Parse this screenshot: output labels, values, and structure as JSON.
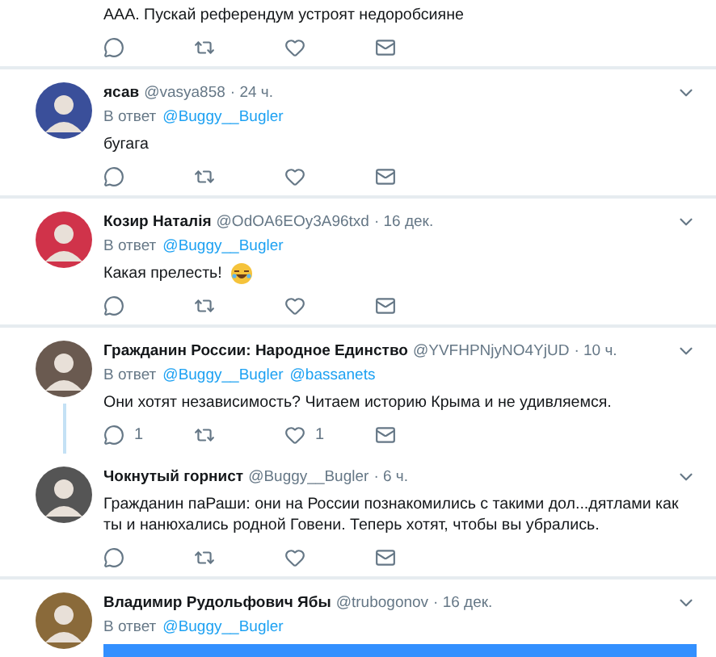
{
  "tweets": [
    {
      "text": "ААА. Пускай референдум устроят недоробсияне"
    },
    {
      "name": "ясав",
      "handle": "@vasya858",
      "time": "· 24 ч.",
      "reply_label": "В ответ",
      "reply_to": [
        "@Buggy__Bugler"
      ],
      "text": "бугага"
    },
    {
      "name": "Козир Наталія",
      "handle": "@OdOA6EOy3A96txd",
      "time": "· 16 дек.",
      "reply_label": "В ответ",
      "reply_to": [
        "@Buggy__Bugler"
      ],
      "text": "Какая прелесть!",
      "emoji": true
    },
    {
      "name": "Гражданин России: Народное Единство",
      "handle": "@YVFHPNjyNO4YjUD",
      "time": "· 10 ч.",
      "reply_label": "В ответ",
      "reply_to": [
        "@Buggy__Bugler",
        "@bassanets"
      ],
      "text": "Они хотят независимость?  Читаем историю Крыма  и не удивляемся.",
      "stats": {
        "replies": "1",
        "likes": "1"
      },
      "thread_line": true
    },
    {
      "name": "Чокнутый горнист",
      "handle": "@Buggy__Bugler",
      "time": "· 6 ч.",
      "text": "Гражданин паРаши: они на России познакомились с такими дол...дятлами как ты и нанюхались родной Говени. Теперь хотят, чтобы вы убрались."
    },
    {
      "name": "Владимир Рудольфович Ябы",
      "handle": "@trubogonov",
      "time": "· 16 дек.",
      "reply_label": "В ответ",
      "reply_to": [
        "@Buggy__Bugler"
      ],
      "highlight": true
    }
  ]
}
